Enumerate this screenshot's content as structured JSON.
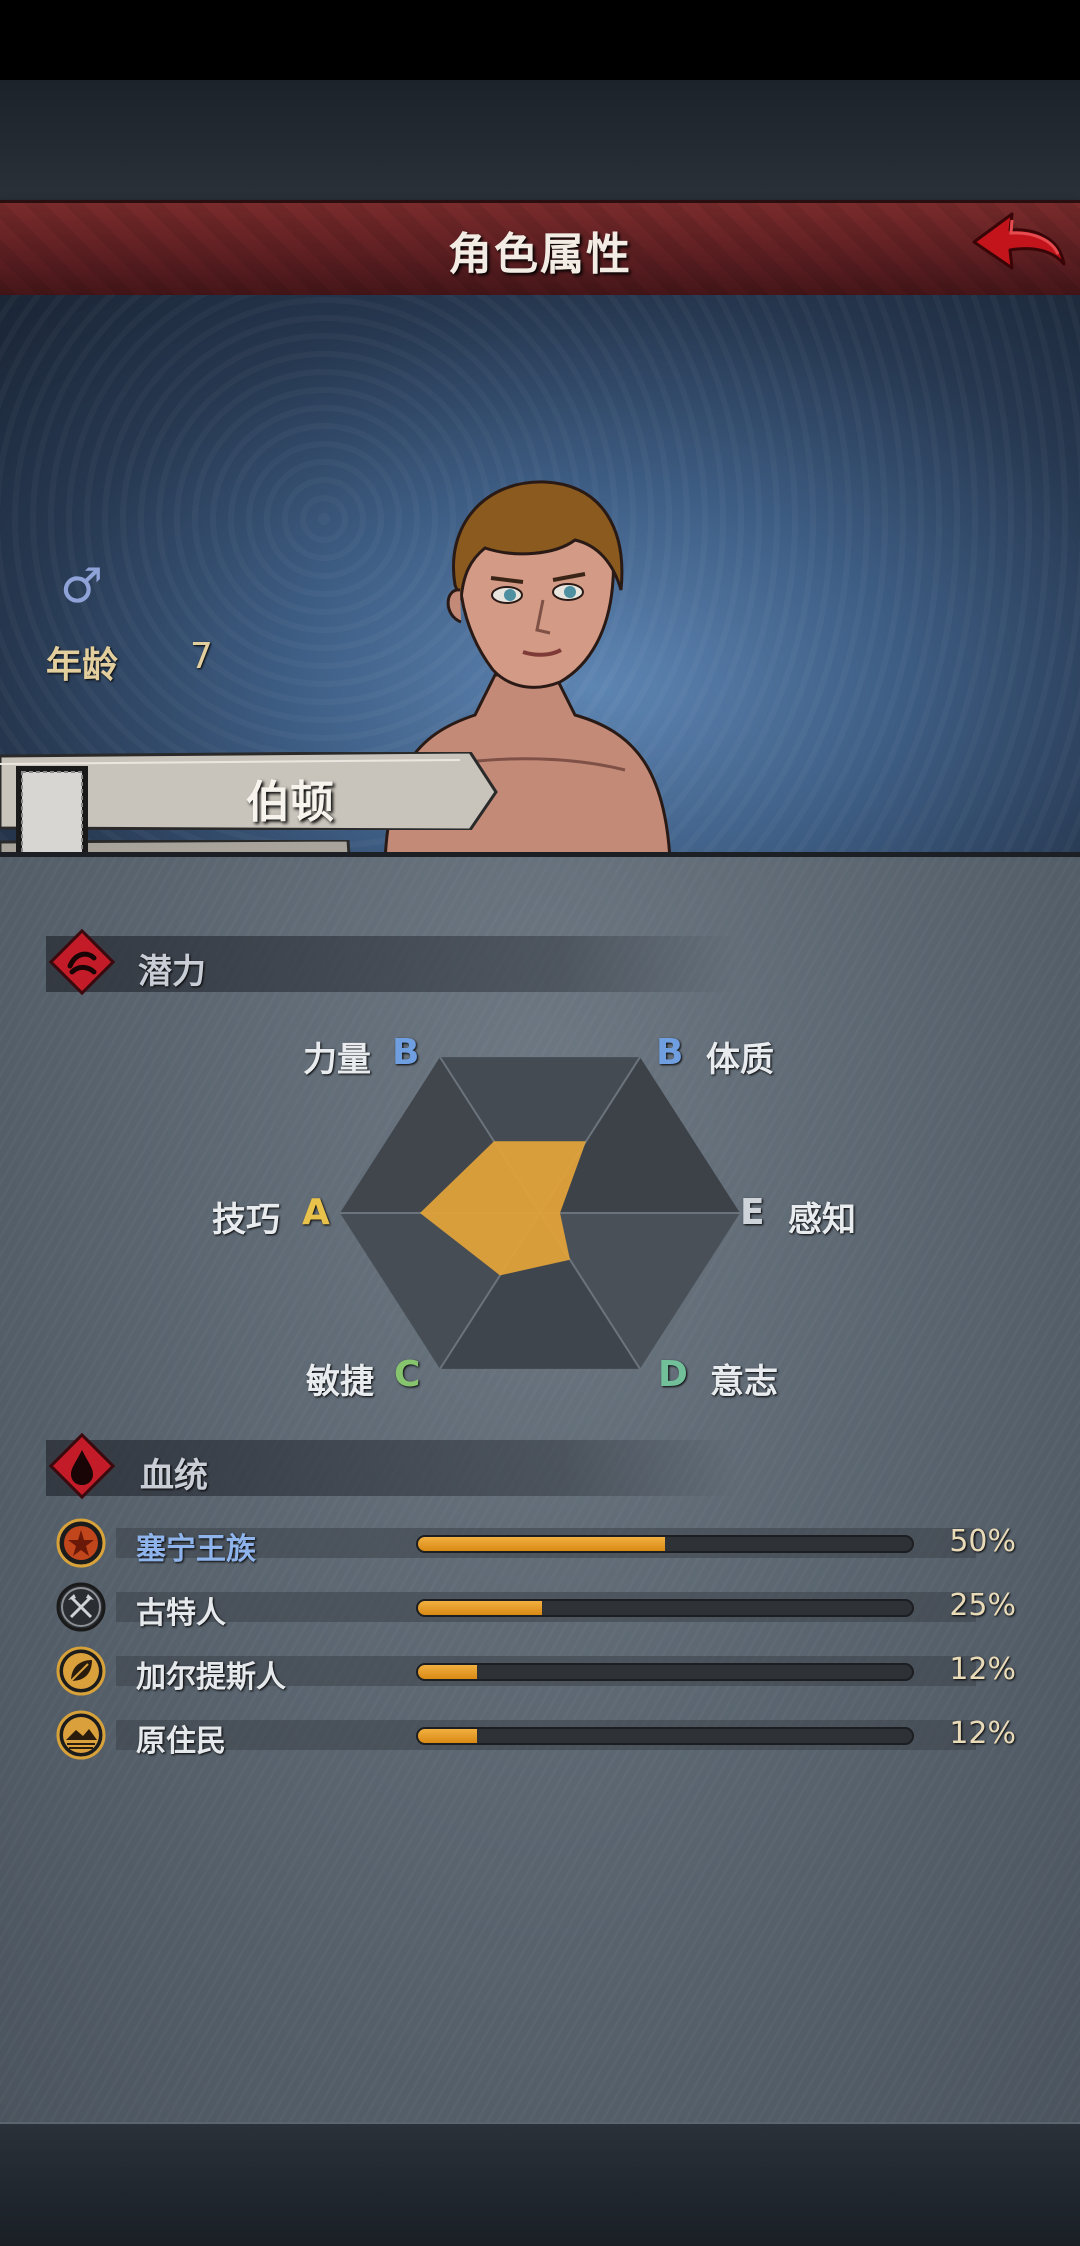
{
  "header": {
    "title": "角色属性"
  },
  "character": {
    "gender_icon": "male-symbol-icon",
    "age_label": "年龄",
    "age_value": "7",
    "name": "伯顿"
  },
  "potential": {
    "title": "潜力",
    "stats": [
      {
        "name": "力量",
        "grade": "B"
      },
      {
        "name": "体质",
        "grade": "B"
      },
      {
        "name": "感知",
        "grade": "E"
      },
      {
        "name": "意志",
        "grade": "D"
      },
      {
        "name": "敏捷",
        "grade": "C"
      },
      {
        "name": "技巧",
        "grade": "A"
      }
    ],
    "grade_colors": {
      "A": "#e8c24a",
      "B": "#6f9fe0",
      "C": "#86c46e",
      "D": "#72c09a",
      "E": "#cfd4da"
    },
    "radar_levels": [
      0.46,
      0.46,
      0.1,
      0.3,
      0.4,
      0.6
    ]
  },
  "lineage": {
    "title": "血统",
    "items": [
      {
        "name": "塞宁王族",
        "percent": "50%",
        "fraction": 0.5,
        "icon": "royal-crest-icon",
        "highlight": true
      },
      {
        "name": "古特人",
        "percent": "25%",
        "fraction": 0.25,
        "icon": "crossed-axes-icon",
        "highlight": false
      },
      {
        "name": "加尔提斯人",
        "percent": "12%",
        "fraction": 0.12,
        "icon": "leaf-icon",
        "highlight": false
      },
      {
        "name": "原住民",
        "percent": "12%",
        "fraction": 0.12,
        "icon": "mountain-sun-icon",
        "highlight": false
      }
    ]
  },
  "colors": {
    "accent": "#e0a23a",
    "banner": "#6b2226",
    "back_arrow": "#c4141b"
  }
}
